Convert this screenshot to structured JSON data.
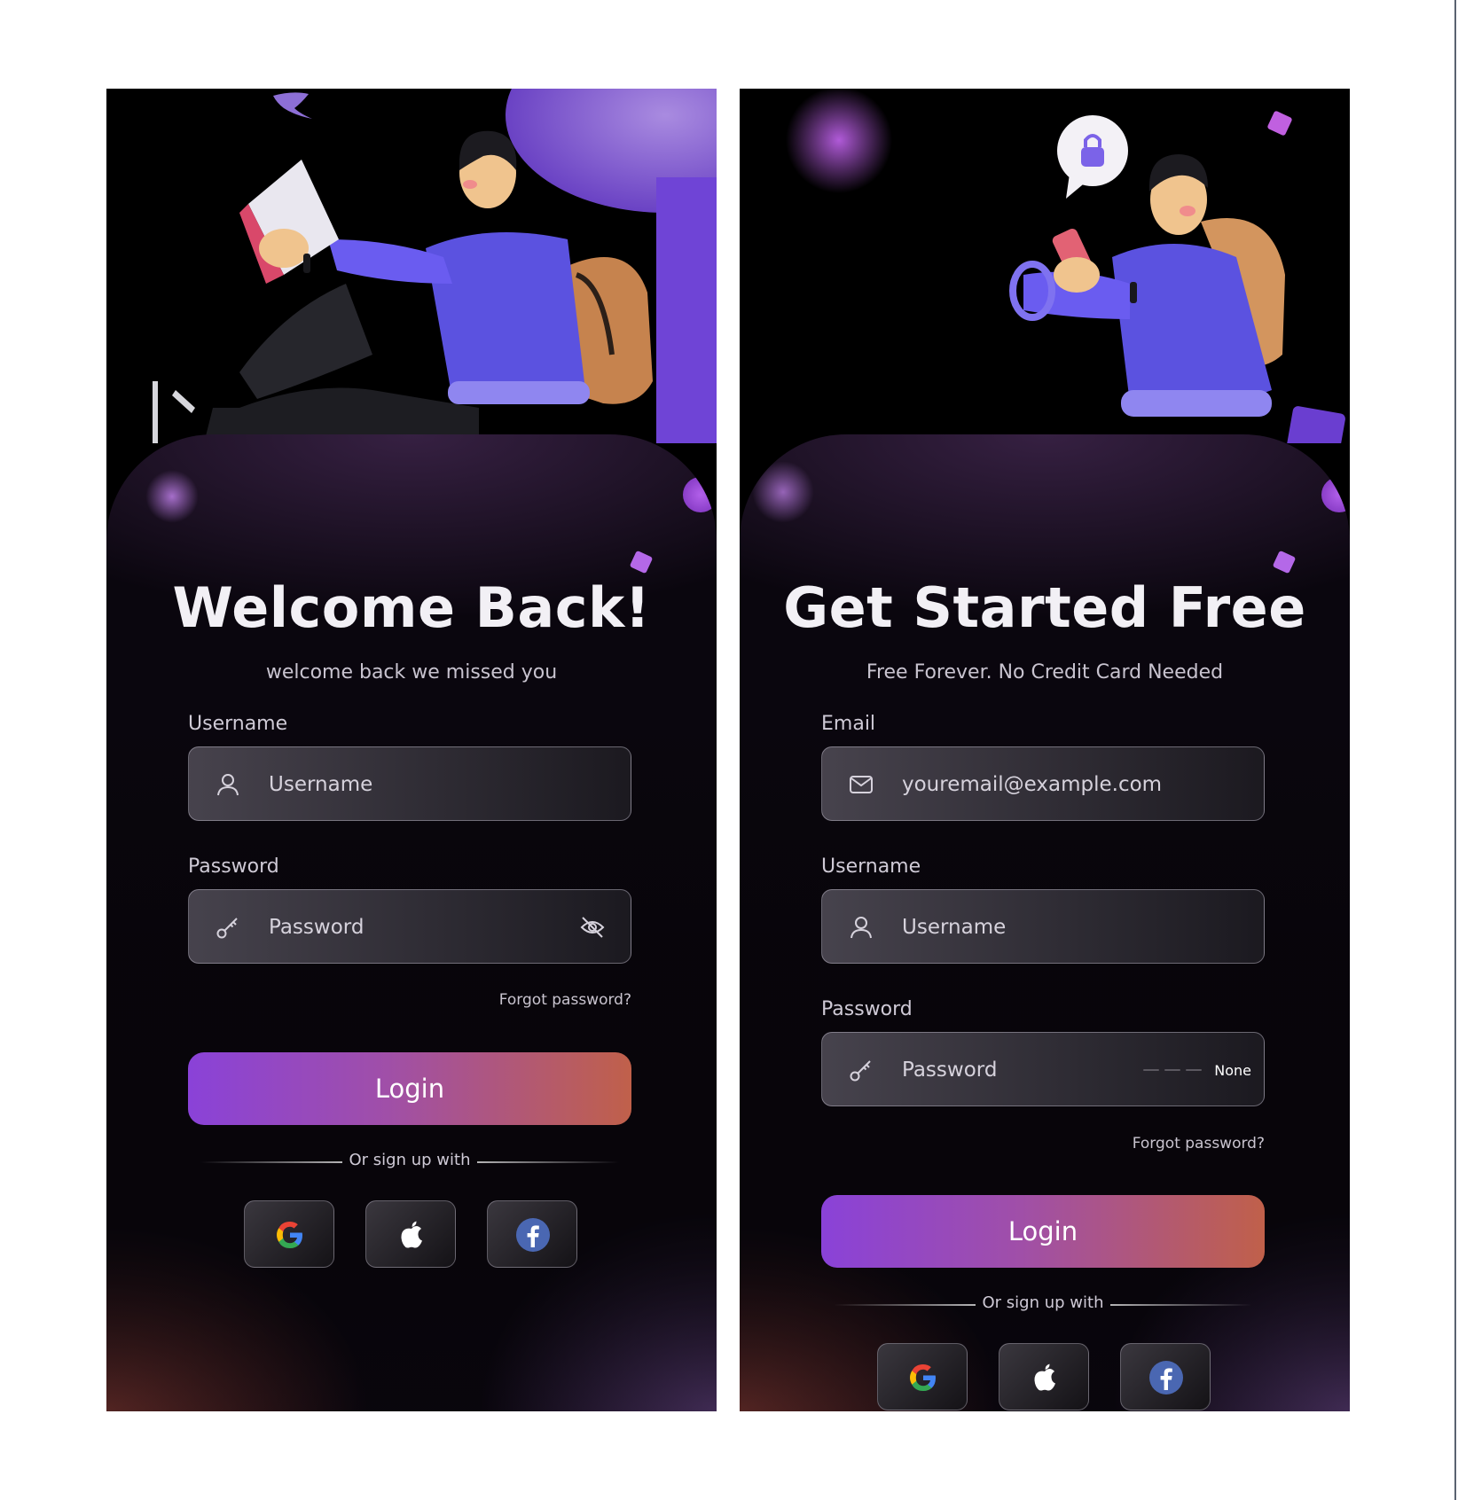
{
  "login_screen": {
    "title": "Welcome Back!",
    "subtitle": "welcome back we missed you",
    "username_label": "Username",
    "username_placeholder": "Username",
    "password_label": "Password",
    "password_placeholder": "Password",
    "forgot_password": "Forgot password?",
    "login_button": "Login",
    "divider_text": "Or sign up with"
  },
  "signup_screen": {
    "title": "Get Started Free",
    "subtitle": "Free Forever. No Credit Card Needed",
    "email_label": "Email",
    "email_placeholder": "youremail@example.com",
    "username_label": "Username",
    "username_placeholder": "Username",
    "password_label": "Password",
    "password_placeholder": "Password",
    "password_strength": "None",
    "forgot_password": "Forgot password?",
    "login_button": "Login",
    "divider_text": "Or sign up with"
  },
  "social_providers": [
    "google-icon",
    "apple-icon",
    "facebook-icon"
  ],
  "colors": {
    "accent_start": "#8a42d8",
    "accent_end": "#c0604a",
    "background": "#000000",
    "text_primary": "#f2f0f5"
  }
}
